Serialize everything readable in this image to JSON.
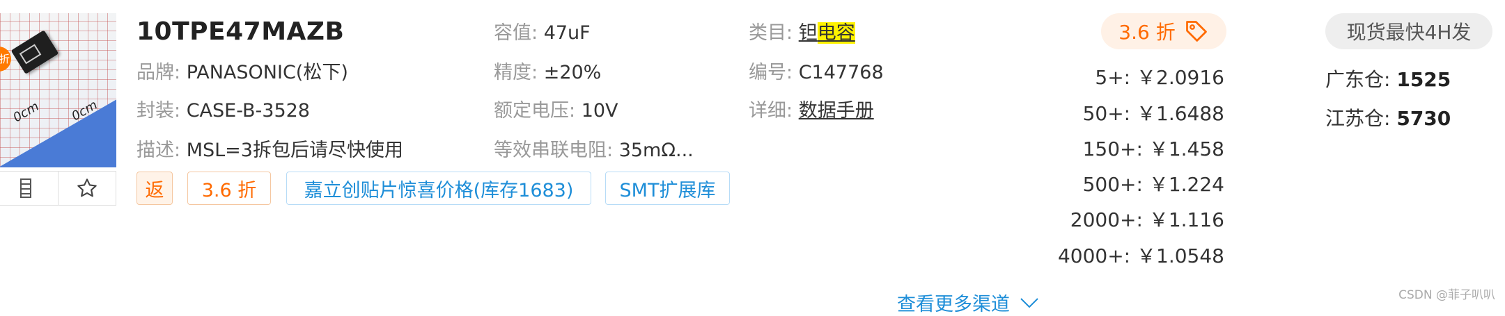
{
  "product": {
    "title": "10TPE47MAZB",
    "thumb_tag": "折",
    "image_text_1": "0cm",
    "image_text_2": "0cm"
  },
  "fields": {
    "brand_label": "品牌:",
    "brand_value": "PANASONIC(松下)",
    "package_label": "封装:",
    "package_value": "CASE-B-3528",
    "desc_label": "描述:",
    "desc_value": "MSL=3拆包后请尽快使用",
    "capacity_label": "容值:",
    "capacity_value": "47uF",
    "tolerance_label": "精度:",
    "tolerance_value": "±20%",
    "voltage_label": "额定电压:",
    "voltage_value": "10V",
    "esr_label": "等效串联电阻:",
    "esr_value": "35mΩ...",
    "category_label": "类目:",
    "category_prefix": "钽",
    "category_highlight": "电容",
    "code_label": "编号:",
    "code_value": "C147768",
    "detail_label": "详细:",
    "detail_value": "数据手册"
  },
  "tags": {
    "rebate": "返",
    "discount": "3.6 折",
    "promo": "嘉立创贴片惊喜价格(库存1683)",
    "smt": "SMT扩展库"
  },
  "pricing": {
    "discount_label": "3.6 折",
    "tiers": [
      {
        "qty": "5+:",
        "price": "￥2.0916"
      },
      {
        "qty": "50+:",
        "price": "￥1.6488"
      },
      {
        "qty": "150+:",
        "price": "￥1.458"
      },
      {
        "qty": "500+:",
        "price": "￥1.224"
      },
      {
        "qty": "2000+:",
        "price": "￥1.116"
      },
      {
        "qty": "4000+:",
        "price": "￥1.0548"
      }
    ]
  },
  "stock": {
    "badge": "现货最快4H发",
    "gd_label": "广东仓:",
    "gd_value": "1525",
    "js_label": "江苏仓:",
    "js_value": "5730"
  },
  "footer": {
    "more_channels": "查看更多渠道",
    "watermark": "CSDN @菲子叭叭"
  },
  "colors": {
    "accent_orange": "#ff6a00",
    "accent_blue": "#1e8ed8",
    "highlight": "#fff200"
  }
}
